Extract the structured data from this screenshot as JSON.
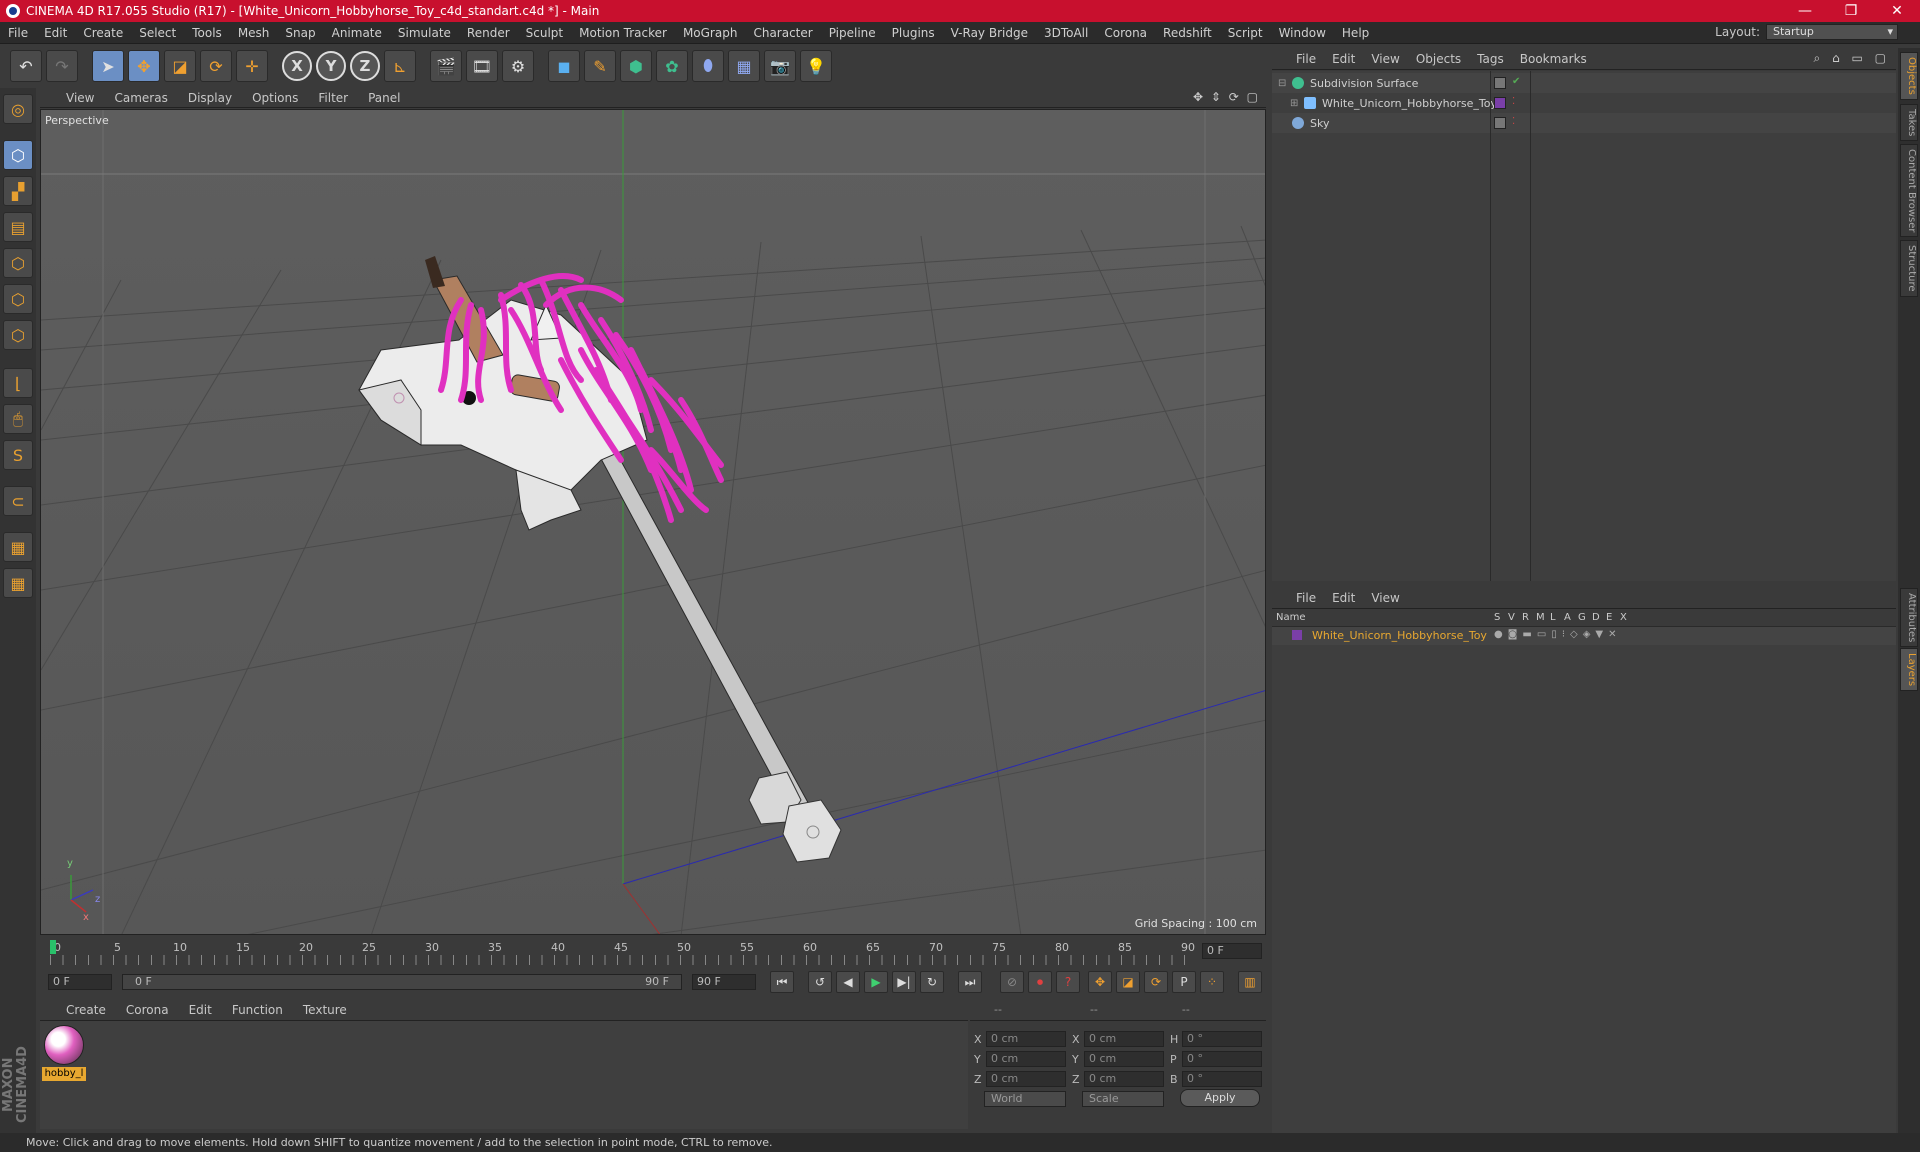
{
  "window": {
    "title": "CINEMA 4D R17.055 Studio (R17) - [White_Unicorn_Hobbyhorse_Toy_c4d_standart.c4d *] - Main",
    "minimize_icon": "minimize-icon",
    "maximize_icon": "restore-icon",
    "close_icon": "close-icon"
  },
  "menubar": {
    "items": [
      "File",
      "Edit",
      "Create",
      "Select",
      "Tools",
      "Mesh",
      "Snap",
      "Animate",
      "Simulate",
      "Render",
      "Sculpt",
      "Motion Tracker",
      "MoGraph",
      "Character",
      "Pipeline",
      "Plugins",
      "V-Ray Bridge",
      "3DToAll",
      "Corona",
      "Redshift",
      "Script",
      "Window",
      "Help"
    ],
    "layout_label": "Layout:",
    "layout_value": "Startup"
  },
  "toolbar": {
    "axis_x": "X",
    "axis_y": "Y",
    "axis_z": "Z"
  },
  "viewport": {
    "menu": [
      "View",
      "Cameras",
      "Display",
      "Options",
      "Filter",
      "Panel"
    ],
    "label": "Perspective",
    "grid_spacing": "Grid Spacing : 100 cm",
    "axis_x": "x",
    "axis_y": "y",
    "axis_z": "z"
  },
  "timeline": {
    "ticks": [
      "0",
      "5",
      "10",
      "15",
      "20",
      "25",
      "30",
      "35",
      "40",
      "45",
      "50",
      "55",
      "60",
      "65",
      "70",
      "75",
      "80",
      "85",
      "90"
    ],
    "current_frame": "0 F"
  },
  "transport": {
    "start_field": "0 F",
    "range_start": "0 F",
    "range_end": "90 F",
    "end_field": "90 F"
  },
  "material_manager": {
    "menu": [
      "Create",
      "Corona",
      "Edit",
      "Function",
      "Texture"
    ],
    "material_name": "hobby_l"
  },
  "coordinates": {
    "headers": [
      "--",
      "--",
      "--"
    ],
    "rows": [
      {
        "axis": "X",
        "pos": "0 cm",
        "axis2": "X",
        "size": "0 cm",
        "rot_label": "H",
        "rot": "0 °"
      },
      {
        "axis": "Y",
        "pos": "0 cm",
        "axis2": "Y",
        "size": "0 cm",
        "rot_label": "P",
        "rot": "0 °"
      },
      {
        "axis": "Z",
        "pos": "0 cm",
        "axis2": "Z",
        "size": "0 cm",
        "rot_label": "B",
        "rot": "0 °"
      }
    ],
    "mode": "World",
    "scale_mode": "Scale",
    "apply": "Apply"
  },
  "object_manager": {
    "menu": [
      "File",
      "Edit",
      "View",
      "Objects",
      "Tags",
      "Bookmarks"
    ],
    "objects": [
      {
        "name": "Subdivision Surface",
        "icon_color": "#3fbf8f"
      },
      {
        "name": "White_Unicorn_Hobbyhorse_Toy",
        "icon_color": "#7fbfff"
      },
      {
        "name": "Sky",
        "icon_color": "#7fa8d8"
      }
    ]
  },
  "layer_manager": {
    "menu": [
      "File",
      "Edit",
      "View"
    ],
    "header_name": "Name",
    "columns": [
      "S",
      "V",
      "R",
      "M",
      "L",
      "A",
      "G",
      "D",
      "E",
      "X"
    ],
    "layer_name": "White_Unicorn_Hobbyhorse_Toy",
    "layer_color": "#7a3fa8"
  },
  "side_tabs": [
    "Objects",
    "Takes",
    "Content Browser",
    "Structure",
    "Attributes",
    "Layers"
  ],
  "status": "Move: Click and drag to move elements. Hold down SHIFT to quantize movement / add to the selection in point mode, CTRL to remove."
}
